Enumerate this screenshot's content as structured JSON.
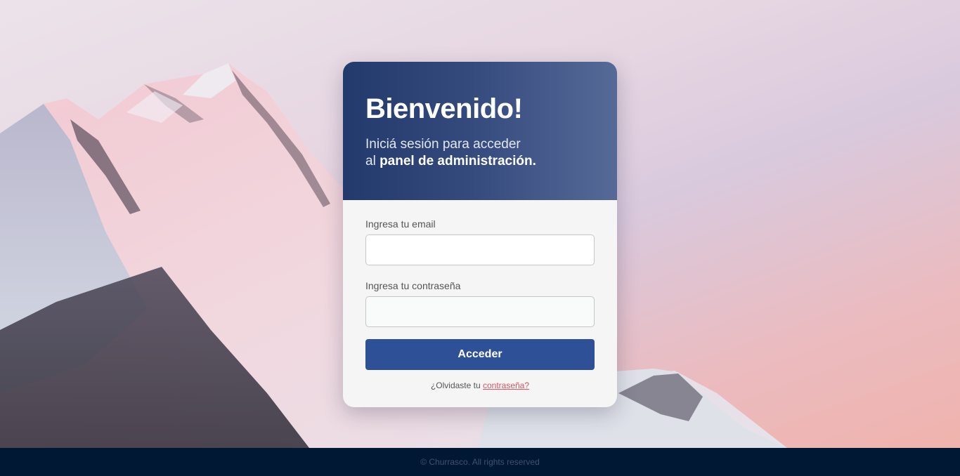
{
  "login_card": {
    "title": "Bienvenido!",
    "subtitle_line1": "Iniciá sesión para acceder",
    "subtitle_line2_prefix": "al ",
    "subtitle_line2_bold": "panel de administración.",
    "email_label": "Ingresa tu email",
    "email_value": "",
    "password_label": "Ingresa tu contraseña",
    "password_value": "",
    "submit_label": "Acceder",
    "forgot_prefix": "¿Olvidaste tu ",
    "forgot_link": "contraseña?"
  },
  "footer": {
    "text": "© Churrasco. All rights reserved"
  },
  "colors": {
    "header_gradient_start": "#233a6c",
    "header_gradient_end": "#566a98",
    "button": "#2d5096",
    "link": "#d9555a",
    "footer": "#001833"
  }
}
